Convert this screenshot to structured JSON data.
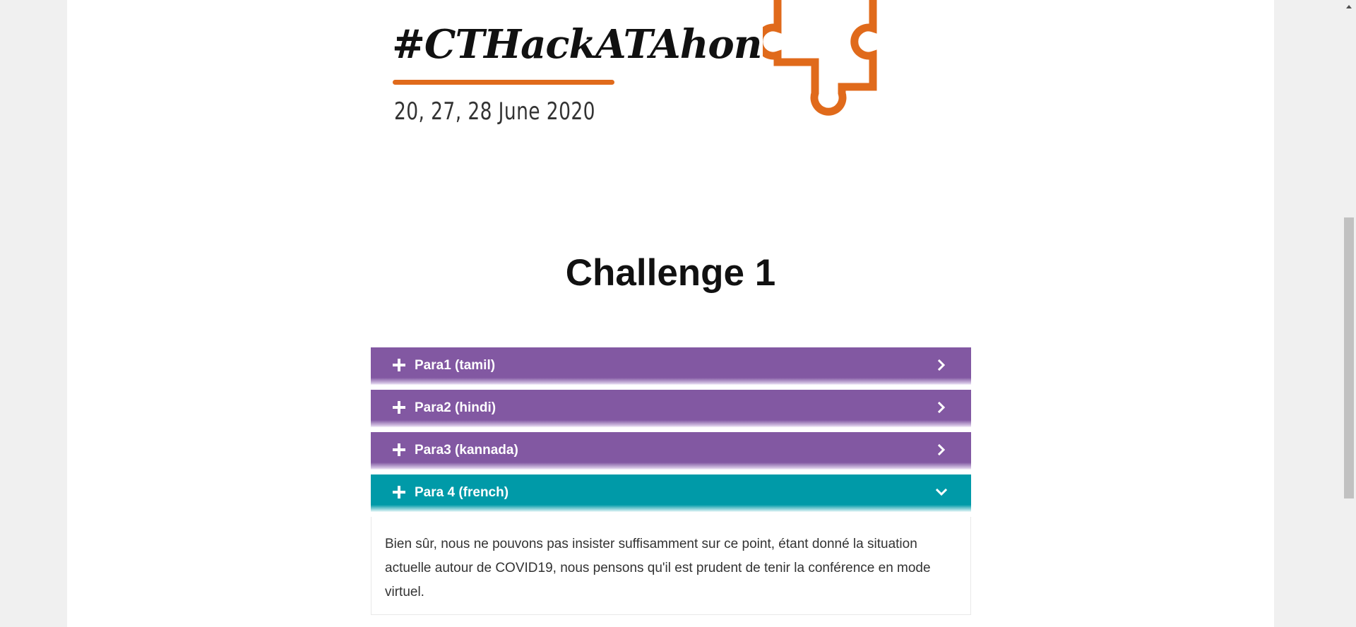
{
  "banner": {
    "hashtag": "#CTHackATAhon",
    "dates": "20, 27, 28 June 2020",
    "accent_color": "#e06a1b"
  },
  "main": {
    "title": "Challenge 1",
    "accordion": [
      {
        "label": "Para1 (tamil)",
        "state": "collapsed",
        "color": "#8258a2"
      },
      {
        "label": "Para2 (hindi)",
        "state": "collapsed",
        "color": "#8258a2"
      },
      {
        "label": "Para3 (kannada)",
        "state": "collapsed",
        "color": "#8258a2"
      },
      {
        "label": "Para 4 (french)",
        "state": "expanded",
        "color": "#009aa8",
        "content": "Bien sûr, nous ne pouvons pas insister suffisamment sur ce point, étant donné la situation actuelle autour de COVID19, nous pensons qu'il est prudent de tenir la conférence en mode virtuel."
      }
    ]
  },
  "icons": {
    "expand": "plus-icon",
    "collapsed_indicator": "chevron-right-icon",
    "expanded_indicator": "chevron-down-icon",
    "logo": "puzzle-piece-icon"
  }
}
